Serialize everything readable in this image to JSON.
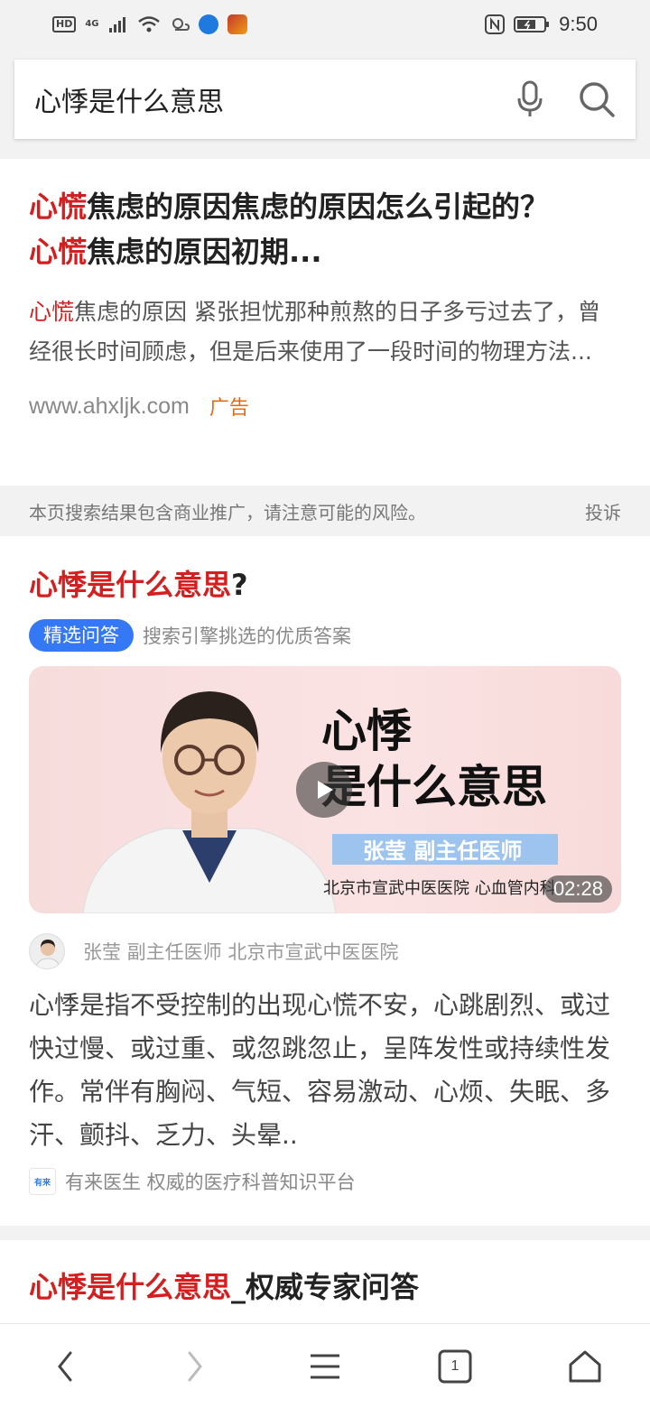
{
  "status_bar": {
    "hd": "HD",
    "network": "4G",
    "time": "9:50"
  },
  "search": {
    "query": "心悸是什么意思"
  },
  "ad_result": {
    "title_hl_1": "心慌",
    "title_part_1": "焦虑的原因焦虑的原因怎么引起的？",
    "title_hl_2": "心慌",
    "title_part_2": "焦虑的原因初期...",
    "desc_hl": "心慌",
    "desc_text": "焦虑的原因 紧张担忧那种煎熬的日子多亏过去了，曾经很长时间顾虑，但是后来使用了一段时间的物理方法...",
    "url": "www.ahxljk.com",
    "ad_label": "广告"
  },
  "notice": {
    "text": "本页搜索结果包含商业推广，请注意可能的风险。",
    "report": "投诉"
  },
  "qa_result": {
    "title_hl": "心悸是什么意思",
    "title_suffix": "?",
    "badge": "精选问答",
    "badge_desc": "搜索引擎挑选的优质答案",
    "video": {
      "title_line1": "心悸",
      "title_line2": "是什么意思",
      "name_tag": "张莹  副主任医师",
      "hospital": "北京市宣武中医医院  心血管内科",
      "duration": "02:28"
    },
    "author": "张莹 副主任医师 北京市宣武中医医院",
    "answer": "心悸是指不受控制的出现心慌不安，心跳剧烈、或过快过慢、或过重、或忽跳忽止，呈阵发性或持续性发作。常伴有胸闷、气短、容易激动、心烦、失眠、多汗、颤抖、乏力、头晕..",
    "source_logo": "有来",
    "source": "有来医生 权威的医疗科普知识平台"
  },
  "next_result": {
    "title_hl": "心悸是什么意思",
    "title_suffix": "_权威专家问答"
  },
  "bottom_nav": {
    "tab_count": "1"
  },
  "colors": {
    "highlight": "#d31f1f",
    "badge_blue": "#3478f6",
    "ad_orange": "#e36b12"
  }
}
